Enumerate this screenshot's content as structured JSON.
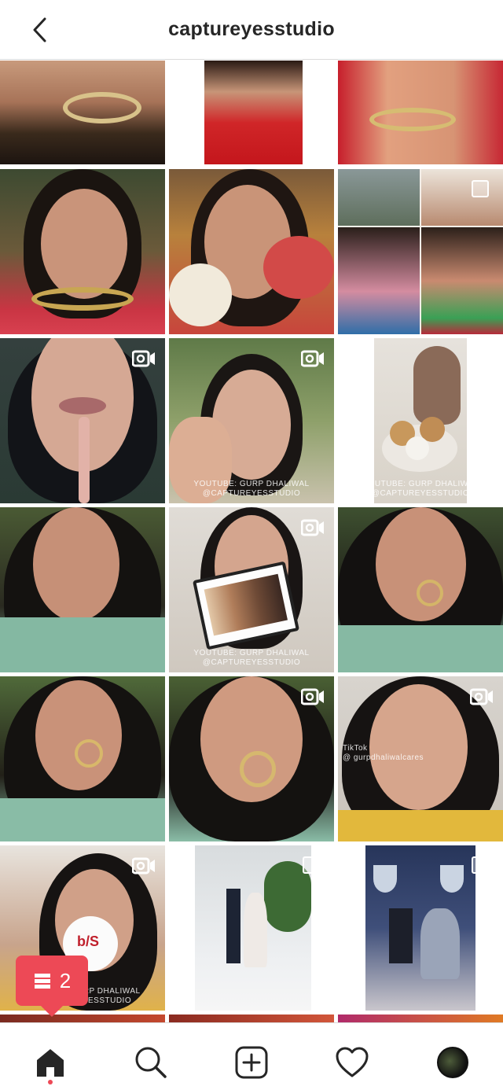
{
  "header": {
    "title": "captureyesstudio",
    "back_icon": "chevron-left-icon"
  },
  "grid": {
    "captions": {
      "c7": "YOUTUBE: GURP DHALIWAL\n@CAPTUREYESSTUDIO",
      "c8": "YOUTUBE: GURP DHALIWAL\n@CAPTUREYESSTUDIO",
      "c10": "YOUTUBE: GURP DHALIWAL\n@CAPTUREYESSTUDIO",
      "c14": "TikTok\n@ gurpdhaliwalcares",
      "c15": "YOUTUBE: GURP DHALIWAL\n@CAPTUREYESSTUDIO",
      "c15b": "b/S"
    }
  },
  "notification": {
    "count": "2",
    "icon": "stack-icon",
    "color": "#ed4956"
  },
  "tabbar": {
    "items": [
      "home-icon",
      "search-icon",
      "new-post-icon",
      "activity-heart-icon",
      "profile-avatar"
    ]
  }
}
